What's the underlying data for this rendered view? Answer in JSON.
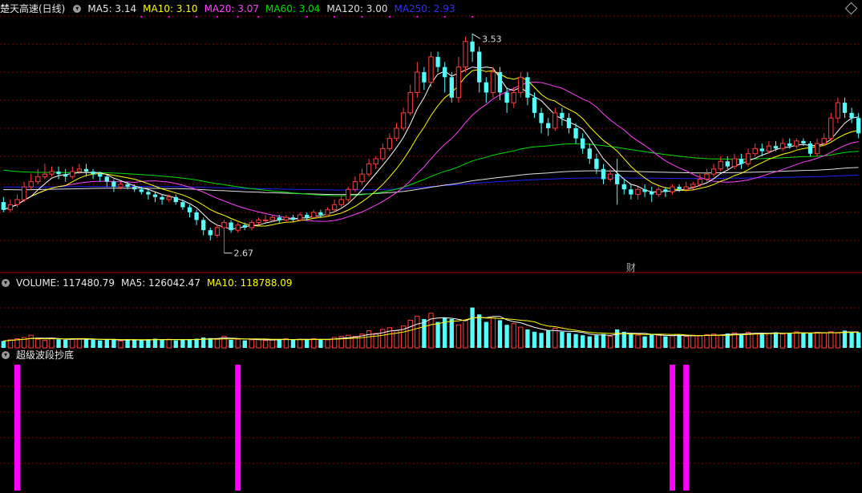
{
  "header": {
    "stock_title": "楚天高速(日线)",
    "ma5_label": "MA5: 3.14",
    "ma10_label": "MA10: 3.10",
    "ma20_label": "MA20: 3.07",
    "ma60_label": "MA60: 3.04",
    "ma120_label": "MA120: 3.00",
    "ma250_label": "MA250: 2.93"
  },
  "volume_header": {
    "volume_label": "VOLUME: 117480.79",
    "ma5_label": "MA5: 126042.47",
    "ma10_label": "MA10: 118788.09"
  },
  "indicator_header": {
    "title": "超级波段抄底"
  },
  "annotations": {
    "high": "3.53",
    "low": "2.67",
    "finance_marker": "财"
  },
  "colors": {
    "up": "#ff3c3c",
    "down": "#54fcfc",
    "ma5": "#ffffff",
    "ma10": "#ffff00",
    "ma20": "#ff40ff",
    "ma60": "#00e000",
    "ma120": "#e0e0e0",
    "ma250": "#2020ff",
    "grid": "#8a0000",
    "signal": "#ff00ff"
  },
  "chart_data": [
    {
      "type": "candlestick",
      "title": "楚天高速(日线)",
      "ylim": [
        2.6,
        3.6
      ],
      "candles": [
        [
          2.87,
          2.84,
          2.89,
          2.83
        ],
        [
          2.84,
          2.86,
          2.88,
          2.83
        ],
        [
          2.86,
          2.88,
          2.9,
          2.85
        ],
        [
          2.88,
          2.93,
          2.95,
          2.87
        ],
        [
          2.93,
          2.95,
          2.98,
          2.92
        ],
        [
          2.95,
          2.97,
          3.0,
          2.94
        ],
        [
          2.97,
          2.98,
          3.02,
          2.96
        ],
        [
          2.98,
          2.99,
          3.01,
          2.97
        ],
        [
          2.99,
          2.98,
          3.01,
          2.96
        ],
        [
          2.98,
          2.97,
          3.0,
          2.95
        ],
        [
          2.97,
          2.99,
          3.01,
          2.96
        ],
        [
          2.99,
          3.0,
          3.02,
          2.98
        ],
        [
          3.0,
          2.99,
          3.02,
          2.97
        ],
        [
          2.99,
          2.98,
          3.0,
          2.96
        ],
        [
          2.98,
          2.97,
          2.99,
          2.95
        ],
        [
          2.97,
          2.95,
          2.98,
          2.93
        ],
        [
          2.95,
          2.93,
          2.96,
          2.91
        ],
        [
          2.93,
          2.94,
          2.95,
          2.92
        ],
        [
          2.94,
          2.93,
          2.95,
          2.92
        ],
        [
          2.93,
          2.92,
          2.94,
          2.91
        ],
        [
          2.92,
          2.91,
          2.93,
          2.9
        ],
        [
          2.91,
          2.9,
          2.92,
          2.88
        ],
        [
          2.9,
          2.89,
          2.91,
          2.87
        ],
        [
          2.89,
          2.88,
          2.9,
          2.86
        ],
        [
          2.88,
          2.89,
          2.9,
          2.87
        ],
        [
          2.89,
          2.87,
          2.9,
          2.86
        ],
        [
          2.87,
          2.85,
          2.88,
          2.84
        ],
        [
          2.85,
          2.83,
          2.86,
          2.81
        ],
        [
          2.83,
          2.8,
          2.84,
          2.78
        ],
        [
          2.8,
          2.76,
          2.81,
          2.74
        ],
        [
          2.76,
          2.74,
          2.77,
          2.72
        ],
        [
          2.74,
          2.77,
          2.78,
          2.73
        ],
        [
          2.77,
          2.79,
          2.8,
          2.67
        ],
        [
          2.79,
          2.76,
          2.8,
          2.75
        ],
        [
          2.76,
          2.78,
          2.79,
          2.75
        ],
        [
          2.78,
          2.77,
          2.79,
          2.76
        ],
        [
          2.77,
          2.79,
          2.8,
          2.76
        ],
        [
          2.79,
          2.8,
          2.81,
          2.78
        ],
        [
          2.8,
          2.8,
          2.82,
          2.79
        ],
        [
          2.8,
          2.81,
          2.82,
          2.79
        ],
        [
          2.81,
          2.8,
          2.82,
          2.79
        ],
        [
          2.8,
          2.81,
          2.82,
          2.79
        ],
        [
          2.81,
          2.8,
          2.82,
          2.79
        ],
        [
          2.8,
          2.82,
          2.83,
          2.8
        ],
        [
          2.82,
          2.81,
          2.83,
          2.8
        ],
        [
          2.81,
          2.83,
          2.84,
          2.81
        ],
        [
          2.83,
          2.82,
          2.84,
          2.81
        ],
        [
          2.82,
          2.84,
          2.85,
          2.82
        ],
        [
          2.84,
          2.86,
          2.88,
          2.83
        ],
        [
          2.86,
          2.88,
          2.9,
          2.85
        ],
        [
          2.88,
          2.92,
          2.93,
          2.87
        ],
        [
          2.92,
          2.95,
          2.97,
          2.91
        ],
        [
          2.95,
          2.98,
          3.0,
          2.94
        ],
        [
          2.98,
          3.02,
          3.04,
          2.97
        ],
        [
          3.02,
          3.04,
          3.05,
          3.0
        ],
        [
          3.04,
          3.08,
          3.1,
          3.03
        ],
        [
          3.08,
          3.12,
          3.14,
          3.07
        ],
        [
          3.12,
          3.16,
          3.18,
          3.11
        ],
        [
          3.16,
          3.22,
          3.24,
          3.15
        ],
        [
          3.22,
          3.3,
          3.33,
          3.21
        ],
        [
          3.3,
          3.38,
          3.42,
          3.28
        ],
        [
          3.38,
          3.34,
          3.4,
          3.31
        ],
        [
          3.34,
          3.44,
          3.46,
          3.32
        ],
        [
          3.44,
          3.4,
          3.46,
          3.38
        ],
        [
          3.4,
          3.36,
          3.42,
          3.3
        ],
        [
          3.36,
          3.28,
          3.38,
          3.26
        ],
        [
          3.28,
          3.4,
          3.44,
          3.26
        ],
        [
          3.4,
          3.5,
          3.52,
          3.38
        ],
        [
          3.5,
          3.46,
          3.53,
          3.42
        ],
        [
          3.46,
          3.34,
          3.48,
          3.3
        ],
        [
          3.34,
          3.3,
          3.36,
          3.26
        ],
        [
          3.3,
          3.38,
          3.4,
          3.28
        ],
        [
          3.38,
          3.3,
          3.4,
          3.27
        ],
        [
          3.3,
          3.26,
          3.32,
          3.22
        ],
        [
          3.26,
          3.3,
          3.32,
          3.24
        ],
        [
          3.3,
          3.36,
          3.38,
          3.28
        ],
        [
          3.36,
          3.28,
          3.38,
          3.25
        ],
        [
          3.28,
          3.22,
          3.3,
          3.2
        ],
        [
          3.22,
          3.18,
          3.24,
          3.14
        ],
        [
          3.18,
          3.16,
          3.2,
          3.13
        ],
        [
          3.16,
          3.22,
          3.24,
          3.15
        ],
        [
          3.22,
          3.2,
          3.24,
          3.17
        ],
        [
          3.2,
          3.16,
          3.22,
          3.14
        ],
        [
          3.16,
          3.12,
          3.18,
          3.1
        ],
        [
          3.12,
          3.08,
          3.14,
          3.06
        ],
        [
          3.08,
          3.04,
          3.1,
          3.02
        ],
        [
          3.04,
          3.0,
          3.06,
          2.98
        ],
        [
          3.0,
          2.96,
          3.02,
          2.94
        ],
        [
          2.96,
          2.98,
          3.0,
          2.95
        ],
        [
          2.98,
          2.94,
          3.04,
          2.86
        ],
        [
          2.94,
          2.92,
          2.96,
          2.9
        ],
        [
          2.92,
          2.9,
          2.94,
          2.88
        ],
        [
          2.9,
          2.92,
          2.93,
          2.88
        ],
        [
          2.92,
          2.91,
          2.94,
          2.89
        ],
        [
          2.91,
          2.9,
          2.93,
          2.87
        ],
        [
          2.9,
          2.92,
          2.93,
          2.89
        ],
        [
          2.92,
          2.91,
          2.93,
          2.89
        ],
        [
          2.91,
          2.93,
          2.94,
          2.9
        ],
        [
          2.93,
          2.92,
          2.94,
          2.91
        ],
        [
          2.92,
          2.93,
          2.95,
          2.91
        ],
        [
          2.93,
          2.94,
          2.95,
          2.92
        ],
        [
          2.94,
          2.96,
          2.98,
          2.93
        ],
        [
          2.96,
          2.98,
          3.0,
          2.95
        ],
        [
          2.98,
          3.0,
          3.02,
          2.97
        ],
        [
          3.0,
          3.03,
          3.05,
          2.99
        ],
        [
          3.03,
          3.01,
          3.05,
          3.0
        ],
        [
          3.01,
          3.04,
          3.06,
          3.0
        ],
        [
          3.04,
          3.02,
          3.06,
          3.0
        ],
        [
          3.02,
          3.06,
          3.08,
          3.01
        ],
        [
          3.06,
          3.08,
          3.1,
          3.05
        ],
        [
          3.08,
          3.07,
          3.1,
          3.05
        ],
        [
          3.07,
          3.09,
          3.11,
          3.06
        ],
        [
          3.09,
          3.08,
          3.11,
          3.07
        ],
        [
          3.08,
          3.1,
          3.12,
          3.07
        ],
        [
          3.1,
          3.09,
          3.12,
          3.08
        ],
        [
          3.09,
          3.11,
          3.12,
          3.08
        ],
        [
          3.11,
          3.1,
          3.12,
          3.09
        ],
        [
          3.1,
          3.06,
          3.11,
          3.05
        ],
        [
          3.06,
          3.1,
          3.12,
          3.05
        ],
        [
          3.1,
          3.12,
          3.14,
          3.09
        ],
        [
          3.12,
          3.2,
          3.22,
          3.11
        ],
        [
          3.2,
          3.26,
          3.28,
          3.18
        ],
        [
          3.26,
          3.22,
          3.28,
          3.2
        ],
        [
          3.22,
          3.2,
          3.24,
          3.18
        ],
        [
          3.2,
          3.14,
          3.22,
          3.12
        ]
      ]
    },
    {
      "type": "bar",
      "title": "VOLUME",
      "values_relative": [
        0.12,
        0.14,
        0.16,
        0.18,
        0.22,
        0.15,
        0.13,
        0.17,
        0.15,
        0.14,
        0.16,
        0.15,
        0.16,
        0.14,
        0.13,
        0.15,
        0.14,
        0.12,
        0.15,
        0.14,
        0.13,
        0.15,
        0.16,
        0.14,
        0.15,
        0.13,
        0.14,
        0.15,
        0.16,
        0.18,
        0.17,
        0.15,
        0.2,
        0.14,
        0.15,
        0.13,
        0.14,
        0.15,
        0.13,
        0.14,
        0.15,
        0.16,
        0.14,
        0.15,
        0.14,
        0.16,
        0.15,
        0.14,
        0.18,
        0.2,
        0.22,
        0.2,
        0.24,
        0.3,
        0.25,
        0.32,
        0.35,
        0.3,
        0.38,
        0.48,
        0.55,
        0.5,
        0.6,
        0.45,
        0.52,
        0.5,
        0.4,
        0.48,
        0.7,
        0.58,
        0.45,
        0.52,
        0.48,
        0.4,
        0.42,
        0.36,
        0.32,
        0.28,
        0.26,
        0.3,
        0.34,
        0.28,
        0.26,
        0.24,
        0.22,
        0.2,
        0.22,
        0.24,
        0.2,
        0.32,
        0.28,
        0.24,
        0.22,
        0.2,
        0.24,
        0.22,
        0.2,
        0.21,
        0.22,
        0.2,
        0.22,
        0.21,
        0.23,
        0.24,
        0.22,
        0.25,
        0.26,
        0.24,
        0.27,
        0.25,
        0.26,
        0.25,
        0.27,
        0.24,
        0.26,
        0.28,
        0.26,
        0.25,
        0.27,
        0.26,
        0.28,
        0.26,
        0.3,
        0.28,
        0.27
      ]
    },
    {
      "type": "bar",
      "title": "超级波段抄底",
      "signal_indices": [
        2,
        34,
        97,
        99
      ]
    }
  ]
}
